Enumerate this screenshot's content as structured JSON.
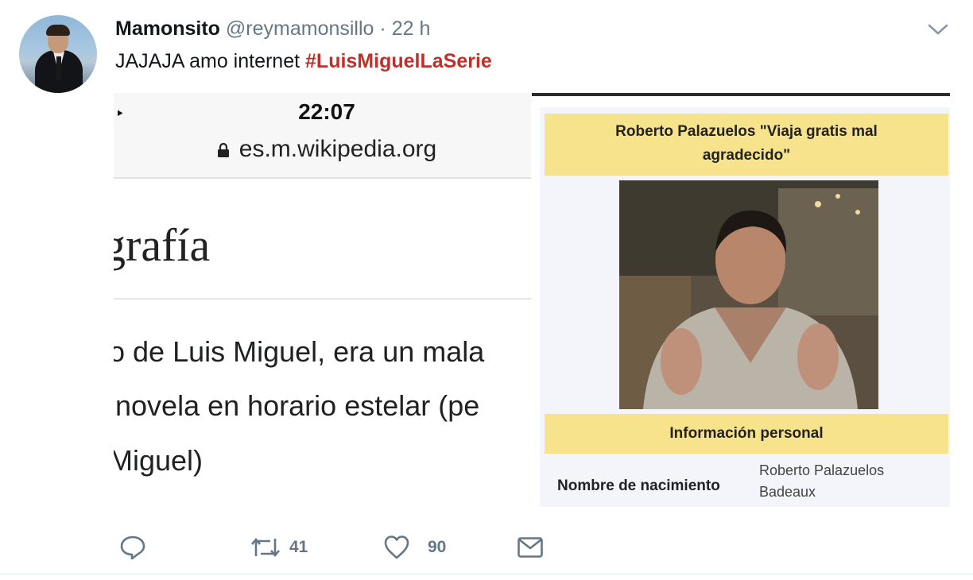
{
  "tweet": {
    "display_name": "Mamonsito",
    "handle": "@reymamonsillo",
    "separator": "·",
    "time": "22 h",
    "text_plain": "JAJAJA amo internet ",
    "hashtag": "#LuisMiguelLaSerie",
    "hashtag_color": "#c0302a"
  },
  "media": {
    "left_screenshot": {
      "status_time": "22:07",
      "url": "es.m.wikipedia.org",
      "heading": "grafía",
      "lines": [
        "o de Luis Miguel, era un mala",
        "novela en horario estelar (pe",
        "Miguel)"
      ]
    },
    "right_screenshot": {
      "caption": "Roberto Palazuelos \"Viaja gratis mal agradecido\"",
      "section_title": "Información personal",
      "field_label": "Nombre de nacimiento",
      "field_value": "Roberto Palazuelos Badeaux",
      "accent_color": "#f8e38d"
    }
  },
  "actions": {
    "reply_icon": "reply-icon",
    "retweet_icon": "retweet-icon",
    "retweet_count": "41",
    "like_icon": "heart-icon",
    "like_count": "90",
    "message_icon": "envelope-icon"
  }
}
